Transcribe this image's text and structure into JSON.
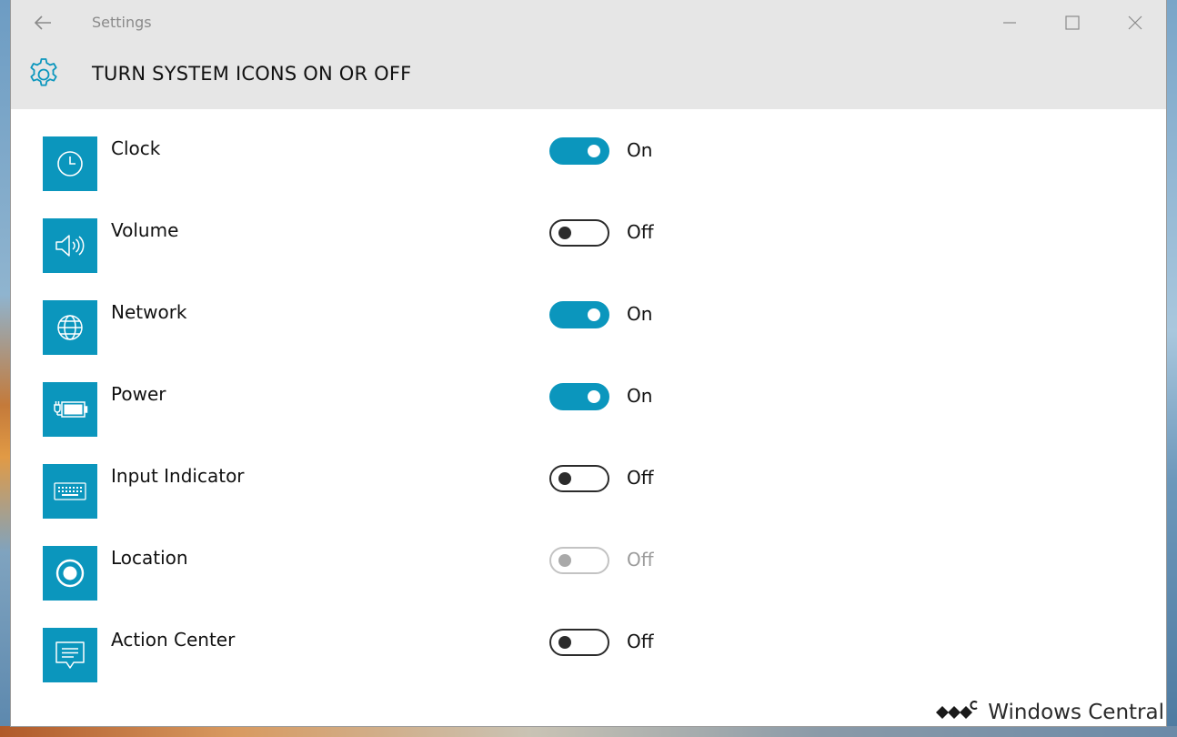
{
  "window": {
    "title": "Settings"
  },
  "header": {
    "title": "TURN SYSTEM ICONS ON OR OFF",
    "icon": "gear-icon"
  },
  "colors": {
    "accent": "#0b96bd",
    "header_bg": "#e6e6e6",
    "toggle_off": "#2b2b2b",
    "toggle_disabled": "#c3c3c3"
  },
  "items": [
    {
      "label": "Clock",
      "state": "On",
      "icon": "clock-icon",
      "enabled": true
    },
    {
      "label": "Volume",
      "state": "Off",
      "icon": "volume-icon",
      "enabled": true
    },
    {
      "label": "Network",
      "state": "On",
      "icon": "globe-icon",
      "enabled": true
    },
    {
      "label": "Power",
      "state": "On",
      "icon": "power-plug-icon",
      "enabled": true
    },
    {
      "label": "Input Indicator",
      "state": "Off",
      "icon": "keyboard-icon",
      "enabled": true
    },
    {
      "label": "Location",
      "state": "Off",
      "icon": "location-icon",
      "enabled": false
    },
    {
      "label": "Action Center",
      "state": "Off",
      "icon": "action-center-icon",
      "enabled": true
    }
  ],
  "watermark": {
    "text": "Windows Central"
  }
}
